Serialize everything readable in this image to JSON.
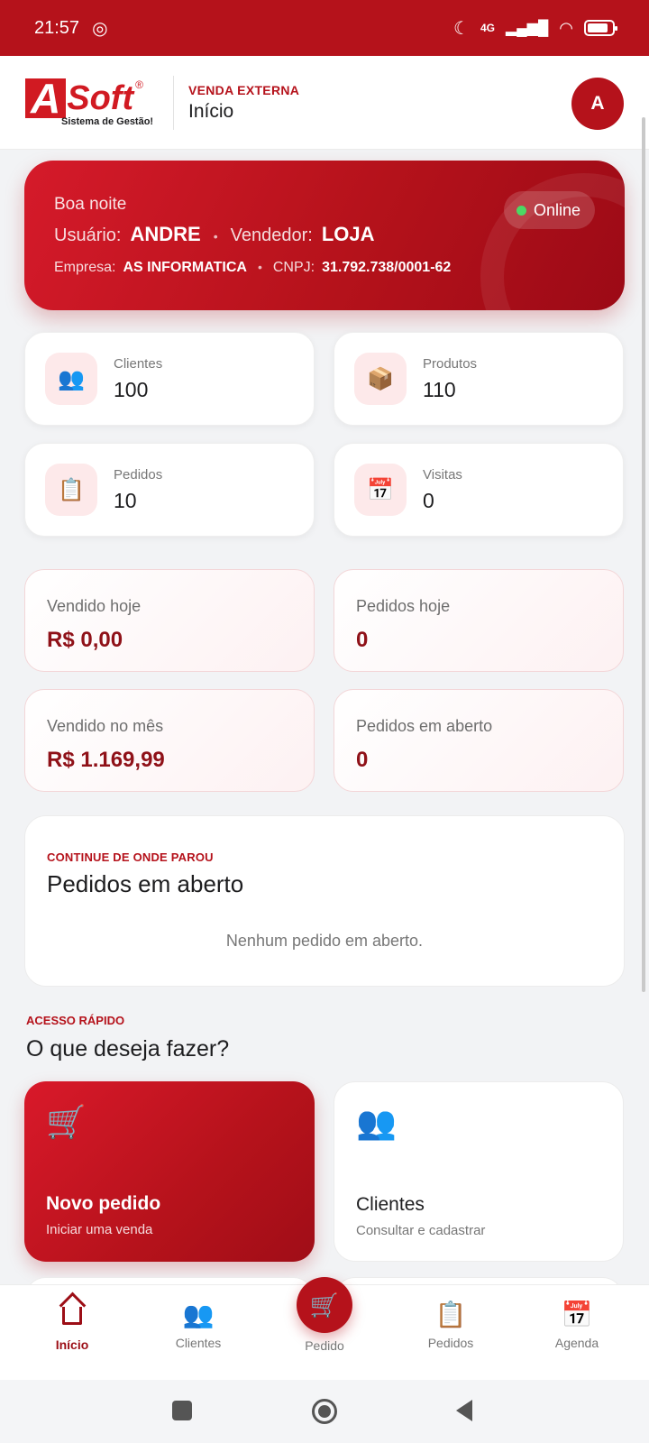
{
  "status_bar": {
    "time": "21:57",
    "network": "4G"
  },
  "header": {
    "logo": {
      "brand_a": "A",
      "brand_soft": "Soft",
      "registered": "®",
      "tagline": "Sistema de Gestão!"
    },
    "subtitle": "VENDA EXTERNA",
    "title": "Início",
    "avatar_letter": "A"
  },
  "greeting": {
    "hello": "Boa noite",
    "user_label": "Usuário:",
    "user_value": "ANDRE",
    "seller_label": "Vendedor:",
    "seller_value": "LOJA",
    "company_label": "Empresa:",
    "company_value": "AS INFORMATICA",
    "cnpj_label": "CNPJ:",
    "cnpj_value": "31.792.738/0001-62",
    "status": "Online",
    "separator": "•"
  },
  "stats": [
    {
      "label": "Clientes",
      "value": "100",
      "icon": "users-icon",
      "glyph": "👥"
    },
    {
      "label": "Produtos",
      "value": "110",
      "icon": "box-icon",
      "glyph": "📦"
    },
    {
      "label": "Pedidos",
      "value": "10",
      "icon": "clipboard-icon",
      "glyph": "📋"
    },
    {
      "label": "Visitas",
      "value": "0",
      "icon": "calendar-icon",
      "glyph": "📅"
    }
  ],
  "metrics": [
    {
      "label": "Vendido hoje",
      "value": "R$ 0,00"
    },
    {
      "label": "Pedidos hoje",
      "value": "0"
    },
    {
      "label": "Vendido no mês",
      "value": "R$ 1.169,99"
    },
    {
      "label": "Pedidos em aberto",
      "value": "0"
    }
  ],
  "open_orders": {
    "kicker": "CONTINUE DE ONDE PAROU",
    "title": "Pedidos em aberto",
    "empty": "Nenhum pedido em aberto."
  },
  "quick_access": {
    "kicker": "ACESSO RÁPIDO",
    "title": "O que deseja fazer?",
    "actions": [
      {
        "title": "Novo pedido",
        "subtitle": "Iniciar uma venda",
        "glyph": "🛒"
      },
      {
        "title": "Clientes",
        "subtitle": "Consultar e cadastrar",
        "glyph": "👥"
      }
    ]
  },
  "bottom_nav": {
    "items": [
      {
        "label": "Início",
        "glyph": ""
      },
      {
        "label": "Clientes",
        "glyph": "👥"
      },
      {
        "label": "Pedido",
        "glyph": "🛒"
      },
      {
        "label": "Pedidos",
        "glyph": "📋"
      },
      {
        "label": "Agenda",
        "glyph": "📅"
      }
    ]
  },
  "colors": {
    "brand": "#b5121b",
    "brand_dark": "#8f1118",
    "online": "#4cd964"
  }
}
